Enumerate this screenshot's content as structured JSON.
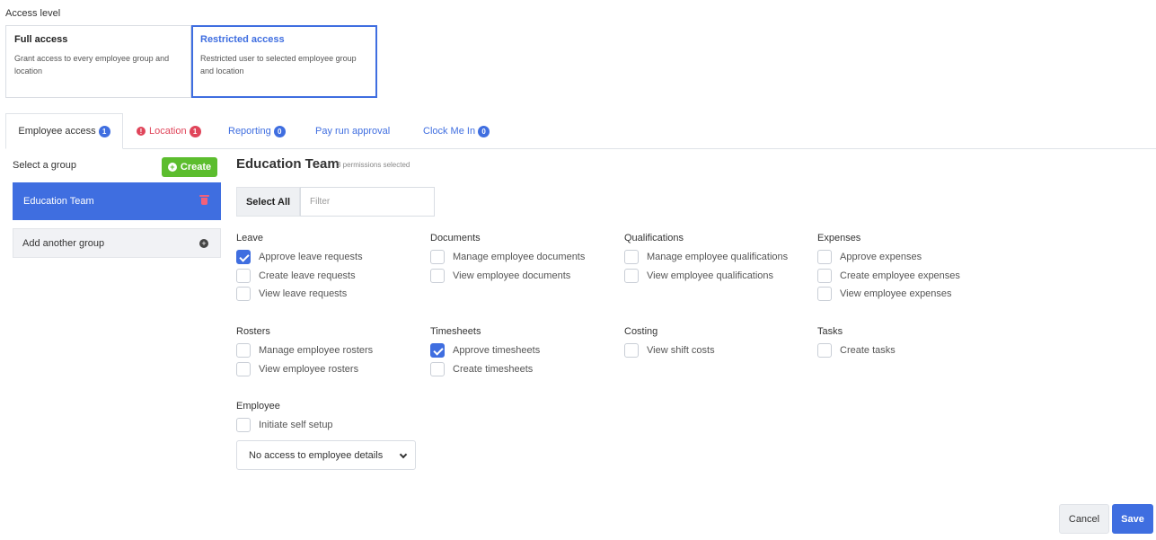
{
  "access": {
    "label": "Access level",
    "full": {
      "title": "Full access",
      "desc": "Grant access to every employee group and location"
    },
    "restricted": {
      "title": "Restricted access",
      "desc": "Restricted user to selected employee group and location",
      "selected": true
    }
  },
  "tabs": [
    {
      "label": "Employee access",
      "badge": "1",
      "active": true
    },
    {
      "label": "Location",
      "badge": "1",
      "error": true
    },
    {
      "label": "Reporting",
      "badge": "0"
    },
    {
      "label": "Pay run approval"
    },
    {
      "label": "Clock Me In",
      "badge": "0"
    }
  ],
  "sidebar": {
    "label": "Select a group",
    "create_label": "Create",
    "groups": [
      {
        "label": "Education Team",
        "active": true
      }
    ],
    "add_label": "Add another group"
  },
  "main": {
    "title": "Education Team",
    "count": "3 permissions selected",
    "select_all": "Select All",
    "filter_placeholder": "Filter"
  },
  "sections": [
    {
      "title": "Leave",
      "items": [
        {
          "label": "Approve leave requests",
          "checked": true
        },
        {
          "label": "Create leave requests",
          "checked": false
        },
        {
          "label": "View leave requests",
          "checked": false
        }
      ]
    },
    {
      "title": "Documents",
      "items": [
        {
          "label": "Manage employee documents",
          "checked": false
        },
        {
          "label": "View employee documents",
          "checked": false
        }
      ]
    },
    {
      "title": "Qualifications",
      "items": [
        {
          "label": "Manage employee qualifications",
          "checked": false
        },
        {
          "label": "View employee qualifications",
          "checked": false
        }
      ]
    },
    {
      "title": "Expenses",
      "items": [
        {
          "label": "Approve expenses",
          "checked": false
        },
        {
          "label": "Create employee expenses",
          "checked": false
        },
        {
          "label": "View employee expenses",
          "checked": false
        }
      ]
    },
    {
      "title": "Rosters",
      "items": [
        {
          "label": "Manage employee rosters",
          "checked": false
        },
        {
          "label": "View employee rosters",
          "checked": false
        }
      ]
    },
    {
      "title": "Timesheets",
      "items": [
        {
          "label": "Approve timesheets",
          "checked": true
        },
        {
          "label": "Create timesheets",
          "checked": false
        }
      ]
    },
    {
      "title": "Costing",
      "items": [
        {
          "label": "View shift costs",
          "checked": false
        }
      ]
    },
    {
      "title": "Tasks",
      "items": [
        {
          "label": "Create tasks",
          "checked": false
        }
      ]
    },
    {
      "title": "Employee",
      "items": [
        {
          "label": "Initiate self setup",
          "checked": false
        }
      ]
    }
  ],
  "employee_select": {
    "value": "No access to employee details"
  },
  "footer": {
    "cancel": "Cancel",
    "save": "Save"
  },
  "colors": {
    "primary": "#3f6ee0",
    "create_green": "#5cbd2e",
    "error": "#e0455a"
  },
  "icons": [
    "plus-circle-icon",
    "trash-icon",
    "chevron-down-icon",
    "error-icon",
    "check-icon"
  ]
}
